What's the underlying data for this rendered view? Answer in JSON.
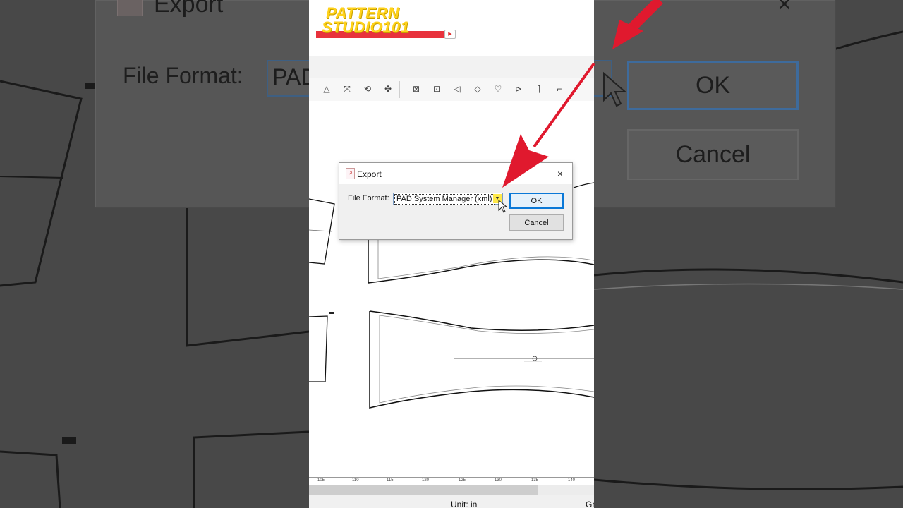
{
  "branding": {
    "line1": "PATTERN",
    "line2": "STUDIO101"
  },
  "dialog": {
    "title": "Export",
    "close_glyph": "×",
    "file_format_label": "File Format:",
    "file_format_value": "PAD System Manager (xml)",
    "ok_label": "OK",
    "cancel_label": "Cancel"
  },
  "background_zoom": {
    "title": "Export",
    "file_format_label": "File Format:",
    "file_format_value_fragment": "PAD",
    "ok_label": "OK",
    "cancel_label": "Cancel",
    "close_glyph": "×"
  },
  "toolbar": {
    "icons": [
      "vertex-icon",
      "move-point-icon",
      "rotate-icon",
      "transform-icon",
      "symmetry-icon",
      "resize-icon",
      "dart-icon",
      "pleat-icon",
      "notch-icon",
      "fold-icon",
      "seam-icon",
      "hem-icon"
    ]
  },
  "ruler": {
    "labels": [
      "105",
      "110",
      "115",
      "120",
      "125",
      "130",
      "135",
      "140"
    ]
  },
  "status": {
    "unit": "Unit: in",
    "grade_fragment": "Gr"
  },
  "colors": {
    "accent": "#0a78d7",
    "arrow": "#e0192e",
    "logo_yellow": "#ffd21a",
    "logo_red": "#e8323c"
  }
}
